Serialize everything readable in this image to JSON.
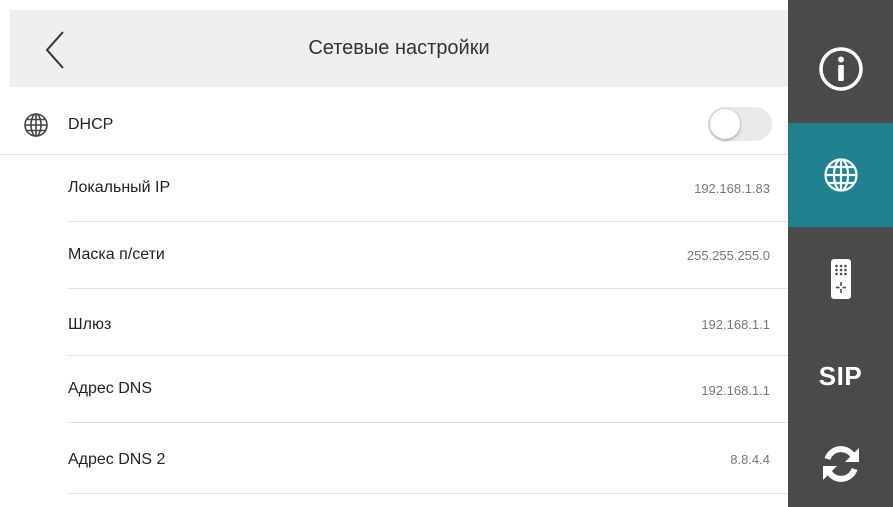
{
  "header": {
    "title": "Сетевые настройки",
    "back_icon": "chevron-left-icon"
  },
  "dhcp": {
    "label": "DHCP",
    "icon": "globe-icon",
    "enabled": false
  },
  "rows": [
    {
      "label": "Локальный IP",
      "value": "192.168.1.83"
    },
    {
      "label": "Маска п/сети",
      "value": "255.255.255.0"
    },
    {
      "label": "Шлюз",
      "value": "192.168.1.1"
    },
    {
      "label": "Адрес DNS",
      "value": "192.168.1.1"
    },
    {
      "label": "Адрес DNS 2",
      "value": "8.8.4.4"
    }
  ],
  "sidebar": {
    "items": [
      {
        "icon": "info-icon"
      },
      {
        "icon": "globe-icon",
        "active": true
      },
      {
        "icon": "intercom-panel-icon"
      },
      {
        "text": "SIP"
      },
      {
        "icon": "refresh-icon"
      }
    ]
  },
  "colors": {
    "sidebar_bg": "#4a4a4a",
    "active_bg": "#21818e",
    "header_bg": "#efefef"
  }
}
